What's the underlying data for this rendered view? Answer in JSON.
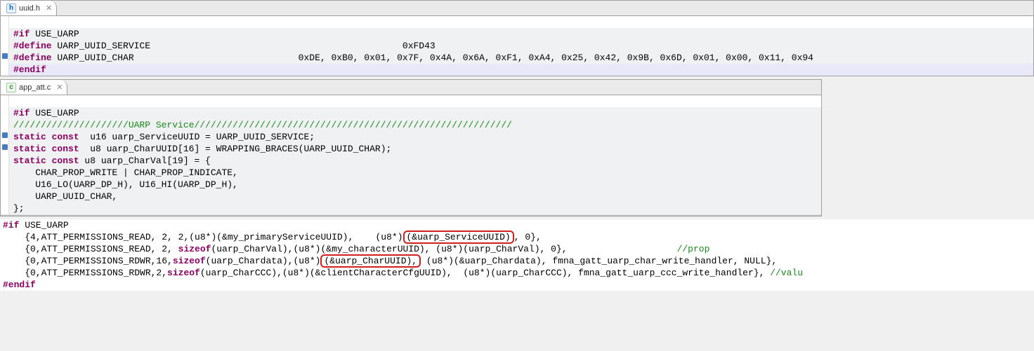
{
  "pane1": {
    "tab_file": "uuid.h",
    "lines": {
      "l1": "#if",
      "l1b": " USE_UARP",
      "l2a": "#define",
      "l2b": " UARP_UUID_SERVICE                                              0xFD43",
      "l3a": "#define",
      "l3b": " UARP_UUID_CHAR                              0xDE, 0xB0, 0x01, 0x7F, 0x4A, 0x6A, 0xF1, 0xA4, 0x25, 0x42, 0x9B, 0x6D, 0x01, 0x00, 0x11, 0x94",
      "l4": "#endif"
    }
  },
  "pane2": {
    "tab_file": "app_att.c",
    "lines": {
      "l1a": "#if",
      "l1b": " USE_UARP",
      "l2": "/////////////////////UARP Service//////////////////////////////////////////////////////////",
      "l3a": "static",
      "l3b": " const",
      "l3c": "  u16 uarp_ServiceUUID = UARP_UUID_SERVICE;",
      "l4a": "static",
      "l4b": " const",
      "l4c": "  u8 uarp_CharUUID[16] = WRAPPING_BRACES(UARP_UUID_CHAR);",
      "l5a": "static",
      "l5b": " const",
      "l5c": " u8 uarp_CharVal[19] = {",
      "l6": "    CHAR_PROP_WRITE | CHAR_PROP_INDICATE,",
      "l7": "    U16_LO(UARP_DP_H), U16_HI(UARP_DP_H),",
      "l8": "    UARP_UUID_CHAR,",
      "l9": "};"
    }
  },
  "pane3": {
    "lines": {
      "l1a": "#if",
      "l1b": " USE_UARP",
      "l2a": "    {4,ATT_PERMISSIONS_READ, 2, 2,(u8*)(&my_primaryServiceUUID),    (u8*)",
      "l2box": "(&uarp_ServiceUUID)",
      "l2b": ", 0},",
      "l3a": "    {0,ATT_PERMISSIONS_READ, 2, ",
      "l3kw": "sizeof",
      "l3b": "(uarp_CharVal),(u8*)(&my_characterUUID), (u8*)(uarp_CharVal), 0},                    ",
      "l3cmt": "//prop",
      "l4a": "    {0,ATT_PERMISSIONS_RDWR,16,",
      "l4kw": "sizeof",
      "l4b": "(uarp_Chardata),(u8*)",
      "l4box": "(&uarp_CharUUID),",
      "l4c": " (u8*)(&uarp_Chardata), fmna_gatt_uarp_char_write_handler, NULL},",
      "l5a": "    {0,ATT_PERMISSIONS_RDWR,2,",
      "l5kw": "sizeof",
      "l5b": "(uarp_CharCCC),(u8*)(&clientCharacterCfgUUID),  (u8*)(uarp_CharCCC), fmna_gatt_uarp_ccc_write_handler}, ",
      "l5cmt": "//valu",
      "l6": "#endif"
    }
  }
}
